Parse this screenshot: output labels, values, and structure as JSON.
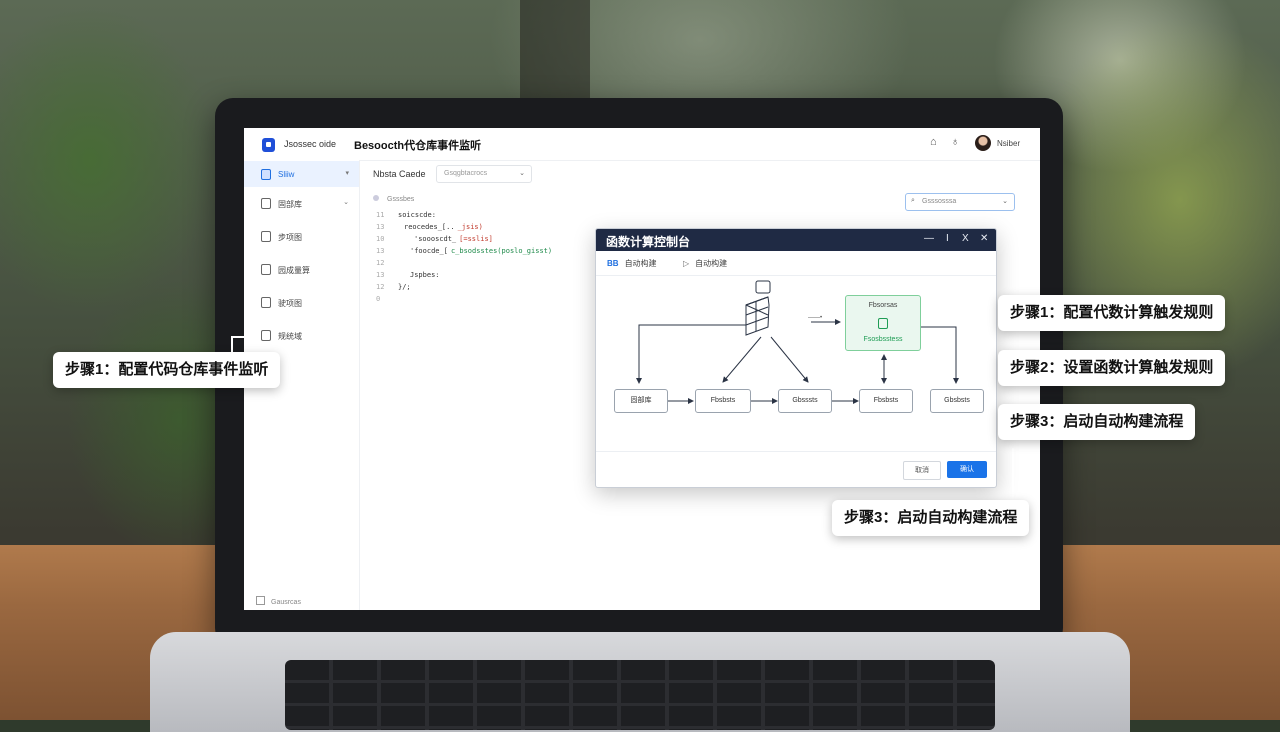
{
  "app": {
    "name": "Jsossec oide",
    "title": "Besoocth代仓库事件监听",
    "username": "Nsiber"
  },
  "sidebar": {
    "items": [
      {
        "label": "Sliiw"
      },
      {
        "label": "固部库"
      },
      {
        "label": "步项图"
      },
      {
        "label": "园成量算"
      },
      {
        "label": "驶项图"
      },
      {
        "label": "规统域"
      }
    ],
    "footer": "Gausrcas"
  },
  "main": {
    "label": "Nbsta Caede",
    "branch_placeholder": "Gsqgbtacrocs",
    "search_placeholder": "Gsssosssa",
    "code_header": "Gsssbes",
    "code_lines": [
      {
        "n": "11",
        "parts": [
          {
            "t": "soicscde:",
            "c": "plain"
          }
        ]
      },
      {
        "n": "13",
        "parts": [
          {
            "t": "reocedes_[..",
            "c": "plain"
          },
          {
            "t": "_jsis)",
            "c": "red"
          }
        ]
      },
      {
        "n": "10",
        "parts": [
          {
            "t": "'soooscdt_",
            "c": "plain"
          },
          {
            "t": "[=sslis]",
            "c": "red"
          }
        ]
      },
      {
        "n": "13",
        "parts": [
          {
            "t": "'foocde_[",
            "c": "plain"
          },
          {
            "t": "c_bsodsstes(poslo_gisst)",
            "c": "green"
          }
        ]
      },
      {
        "n": "12",
        "parts": [
          {
            "t": "",
            "c": "plain"
          }
        ]
      },
      {
        "n": "13",
        "parts": [
          {
            "t": "Jspbes:",
            "c": "plain"
          }
        ]
      },
      {
        "n": "12",
        "parts": [
          {
            "t": "}/;",
            "c": "plain"
          }
        ]
      },
      {
        "n": "0",
        "parts": [
          {
            "t": "",
            "c": "plain"
          }
        ]
      }
    ]
  },
  "dialog": {
    "title": "函数计算控制台",
    "controls": [
      "—",
      "I",
      "X",
      "✕"
    ],
    "tabs": [
      {
        "box": "BB",
        "label": "自动构建"
      },
      {
        "box": "▷",
        "label": "自动构建"
      }
    ],
    "nodes": {
      "green_title": "Fbsorsas",
      "green_sub": "Fsosbsstess",
      "n1": "固部库",
      "n2": "Fbsbsts",
      "n3": "Gbsssts",
      "n4": "Fbsbsts",
      "n5": "Gbsbsts"
    },
    "edge_label": "——•",
    "cancel_label": "取消",
    "ok_label": "确认"
  },
  "callouts": {
    "left": "步骤1：配置代码仓库事件监听",
    "r1": "步骤1：配置代数计算触发规则",
    "r2": "步骤2：设置函数计算触发规则",
    "r3": "步骤3：启动自动构建流程",
    "bottom": "步骤3：启动自动构建流程"
  },
  "colors": {
    "accent": "#1a73e8",
    "dialog_header": "#1f2a44",
    "success": "#1f9d55"
  }
}
